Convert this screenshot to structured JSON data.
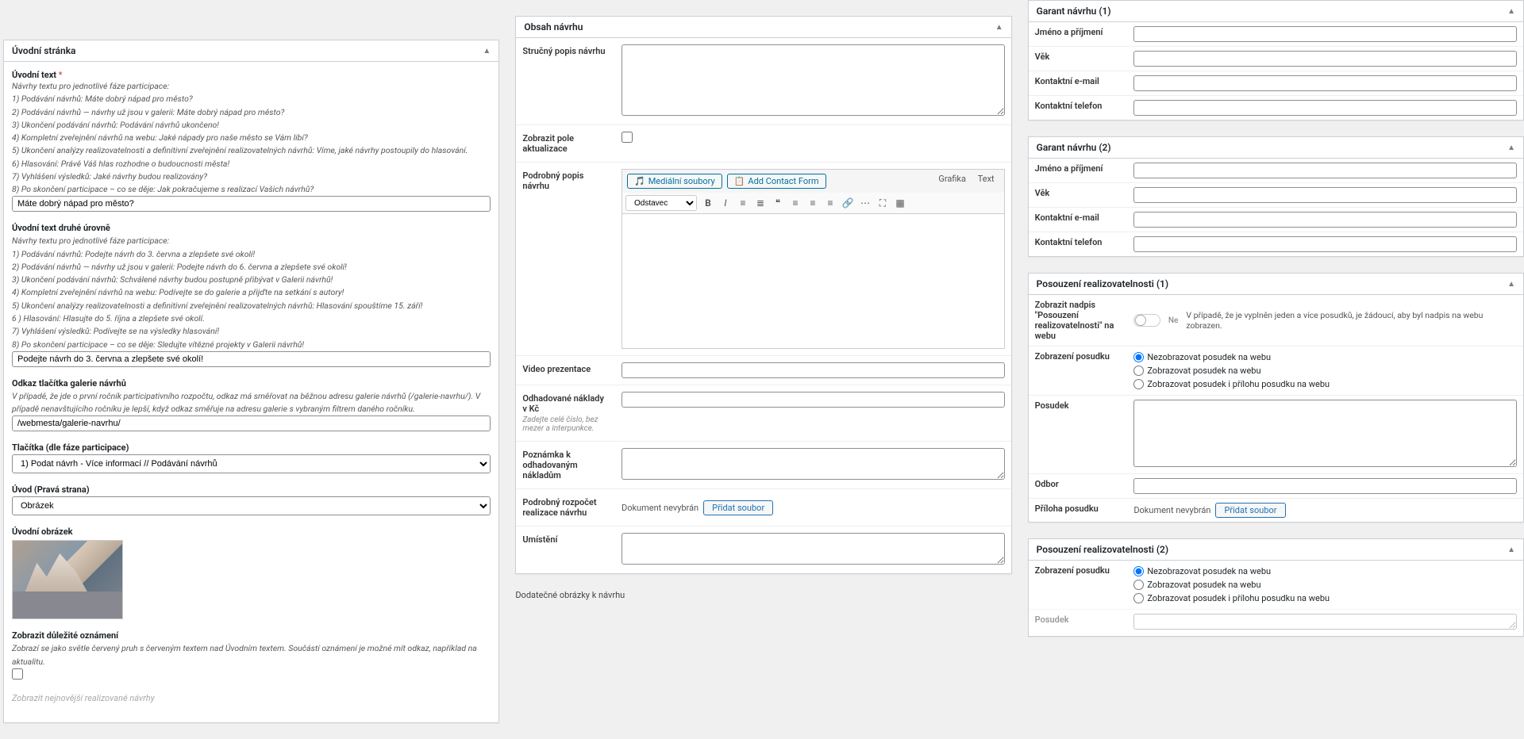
{
  "col1": {
    "panel_title": "Úvodní stránka",
    "f1": {
      "label": "Úvodní text",
      "hint_lead": "Návrhy textu pro jednotlivé fáze participace:",
      "hints": [
        "1) Podávání návrhů: Máte dobrý nápad pro město?",
        "2) Podávání návrhů — návrhy už jsou v galerii: Máte dobrý nápad pro město?",
        "3) Ukončení podávání návrhů: Podávání návrhů ukončeno!",
        "4) Kompletní zveřejnění návrhů na webu: Jaké nápady pro naše město se Vám líbí?",
        "5) Ukončení analýzy realizovatelnosti a definitivní zveřejnění realizovatelných návrhů: Víme, jaké návrhy postoupily do hlasování.",
        "6) Hlasování: Právě Váš hlas rozhodne o budoucnosti města!",
        "7) Vyhlášení výsledků: Jaké návrhy budou realizovány?",
        "8) Po skončení participace – co se děje: Jak pokračujeme s realizací Vašich návrhů?"
      ],
      "value": "Máte dobrý nápad pro město?"
    },
    "f2": {
      "label": "Úvodní text druhé úrovně",
      "hint_lead": "Návrhy textu pro jednotlivé fáze participace:",
      "hints": [
        "1) Podávání návrhů: Podejte návrh do 3. června a zlepšete své okolí!",
        "2) Podávání návrhů — návrhy už jsou v galerii: Podejte návrh do 6. června a zlepšete své okolí!",
        "3) Ukončení podávání návrhů: Schválené návrhy budou postupně přibývat v Galerii návrhů!",
        "4) Kompletní zveřejnění návrhů na webu: Podívejte se do galerie a přijďte na setkání s autory!",
        "5) Ukončení analýzy realizovatelnosti a definitivní zveřejnění realizovatelných návrhů: Hlasování spouštíme 15. září!",
        "6 ) Hlasování: Hlasujte do 5. října a zlepšete své okolí.",
        "7) Vyhlášení výsledků: Podívejte se na výsledky hlasování!",
        "8) Po skončení participace – co se děje: Sledujte vítězné projekty v Galerii návrhů!"
      ],
      "value": "Podejte návrh do 3. června a zlepšete své okolí!"
    },
    "f3": {
      "label": "Odkaz tlačítka galerie návrhů",
      "hint": "V případě, že jde o první ročník participativního rozpočtu, odkaz má směřovat na běžnou adresu galerie návrhů (/galerie-navrhu/). V případě nenavštujícího ročníku je lepší, když odkaz směřuje na adresu galerie s vybraným filtrem daného ročníku.",
      "value": "/webmesta/galerie-navrhu/"
    },
    "f4": {
      "label": "Tlačítka (dle fáze participace)",
      "value": "1) Podat návrh - Více informací // Podávání návrhů"
    },
    "f5": {
      "label": "Úvod (Pravá strana)",
      "value": "Obrázek"
    },
    "f6": {
      "label": "Úvodní obrázek"
    },
    "f7": {
      "label": "Zobrazit důležité oznámení",
      "hint": "Zobrazí se jako světle červený pruh s červeným textem nad Úvodním textem. Součástí oznámení je možné mít odkaz, například na aktualitu."
    },
    "f8_label": "Zobrazit nejnovější realizované návrhy"
  },
  "col2": {
    "panel_title": "Obsah návrhu",
    "f1": {
      "label": "Stručný popis návrhu"
    },
    "f2": {
      "label": "Zobrazit pole aktualizace"
    },
    "f3": {
      "label": "Podrobný popis návrhu",
      "btn_media": "Mediální soubory",
      "btn_contact": "Add Contact Form",
      "tab_visual": "Grafika",
      "tab_text": "Text",
      "format_select": "Odstavec"
    },
    "f4": {
      "label": "Video prezentace"
    },
    "f5": {
      "label": "Odhadované náklady v Kč",
      "hint": "Zadejte celé číslo, bez mezer a interpunkce."
    },
    "f6": {
      "label": "Poznámka k odhadovaným nákladům"
    },
    "f7": {
      "label": "Podrobný rozpočet realizace návrhu",
      "nofile": "Dokument nevybrán",
      "btn": "Přidat soubor"
    },
    "f8": {
      "label": "Umístění"
    },
    "footer": "Dodatečné obrázky k návrhu"
  },
  "col3": {
    "g1": {
      "title": "Garant návrhu (1)",
      "name": "Jméno a příjmení",
      "age": "Věk",
      "email": "Kontaktní e-mail",
      "phone": "Kontaktní telefon"
    },
    "g2": {
      "title": "Garant návrhu (2)",
      "name": "Jméno a příjmení",
      "age": "Věk",
      "email": "Kontaktní e-mail",
      "phone": "Kontaktní telefon"
    },
    "p1": {
      "title": "Posouzení realizovatelnosti (1)",
      "show_label": "Zobrazit nadpis \"Posouzení realizovatelnosti\" na webu",
      "switch_text": "Ne",
      "switch_hint": "V případě, že je vyplněn jeden a více posudků, je žádoucí, aby byl nadpis na webu zobrazen.",
      "radio_label": "Zobrazení posudku",
      "r1": "Nezobrazovat posudek na webu",
      "r2": "Zobrazovat posudek na webu",
      "r3": "Zobrazovat posudek i přílohu posudku na webu",
      "posudek": "Posudek",
      "odbor": "Odbor",
      "priloha": "Příloha posudku",
      "nofile": "Dokument nevybrán",
      "btn": "Přidat soubor"
    },
    "p2": {
      "title": "Posouzení realizovatelnosti (2)",
      "radio_label": "Zobrazení posudku",
      "r1": "Nezobrazovat posudek na webu",
      "r2": "Zobrazovat posudek na webu",
      "r3": "Zobrazovat posudek i přílohu posudku na webu",
      "posudek": "Posudek"
    }
  }
}
